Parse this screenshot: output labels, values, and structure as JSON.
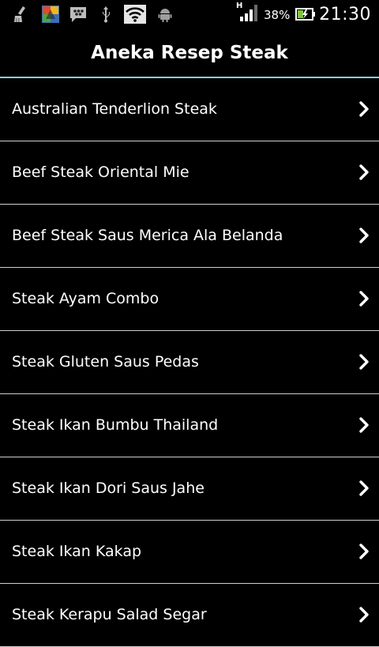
{
  "status_bar": {
    "icons": [
      "broom-icon",
      "android-apps-icon",
      "bbm-chat-icon",
      "usb-icon",
      "wifi-icon",
      "android-debug-icon"
    ],
    "network_type": "H",
    "battery_percent": "38%",
    "time": "21:30"
  },
  "app_bar": {
    "title": "Aneka Resep Steak",
    "accent_color": "#7fd3ea"
  },
  "recipes": [
    {
      "label": "Australian Tenderlion Steak"
    },
    {
      "label": "Beef Steak Oriental Mie"
    },
    {
      "label": "Beef Steak Saus Merica Ala Belanda"
    },
    {
      "label": "Steak Ayam Combo"
    },
    {
      "label": "Steak Gluten Saus Pedas"
    },
    {
      "label": "Steak Ikan Bumbu Thailand"
    },
    {
      "label": "Steak Ikan Dori Saus Jahe"
    },
    {
      "label": "Steak Ikan Kakap"
    },
    {
      "label": "Steak Kerapu Salad Segar"
    }
  ]
}
